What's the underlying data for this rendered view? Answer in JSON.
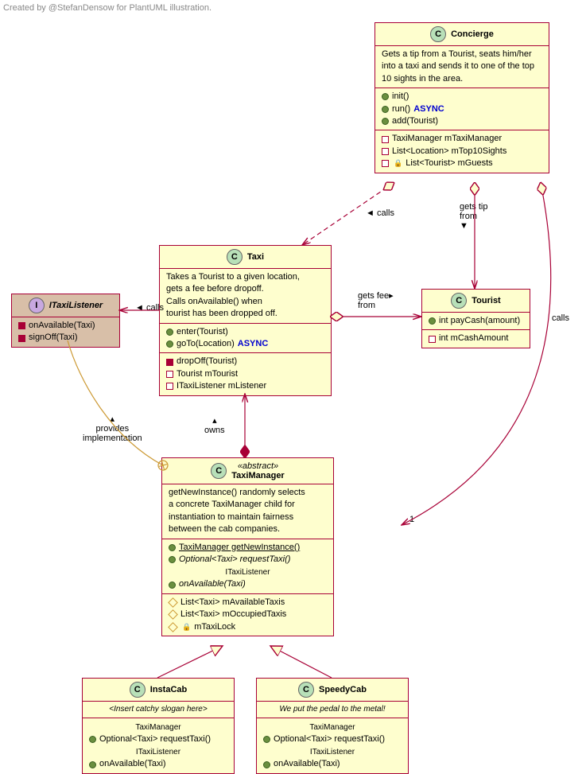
{
  "caption": "Created by @StefanDensow for PlantUML illustration.",
  "concierge": {
    "name": "Concierge",
    "desc": "Gets a tip from a Tourist, seats him/her into a taxi and sends it to one of the top 10 sights in the area.",
    "m_init": "init()",
    "m_run": "run()",
    "m_run_a": "ASYNC",
    "m_add": "add(Tourist)",
    "f1": "TaxiManager mTaxiManager",
    "f2": "List<Location> mTop10Sights",
    "f3": "List<Tourist> mGuests"
  },
  "taxi": {
    "name": "Taxi",
    "descL1": "Takes a Tourist to a given location,",
    "descL2": "gets a fee before dropoff.",
    "descL3": "Calls onAvailable() when",
    "descL4": "tourist has been dropped off.",
    "m_enter": "enter(Tourist)",
    "m_goto": "goTo(Location)",
    "m_goto_a": "ASYNC",
    "m_drop": "dropOff(Tourist)",
    "f1": "Tourist mTourist",
    "f2": "ITaxiListener mListener"
  },
  "itl": {
    "name": "ITaxiListener",
    "m1": "onAvailable(Taxi)",
    "m2": "signOff(Taxi)"
  },
  "tourist": {
    "name": "Tourist",
    "m1": "int payCash(amount)",
    "f1": "int mCashAmount"
  },
  "tm": {
    "stereo": "«abstract»",
    "name": "TaxiManager",
    "d1": "getNewInstance() randomly selects",
    "d2": "a concrete TaxiManager child for",
    "d3": "instantiation to maintain fairness",
    "d4": "between the cab companies.",
    "m1": "TaxiManager getNewInstance()",
    "m2": "Optional<Taxi> requestTaxi()",
    "sep1": "ITaxiListener",
    "m3": "onAvailable(Taxi)",
    "f1": "List<Taxi> mAvailableTaxis",
    "f2": "List<Taxi> mOccupiedTaxis",
    "f3": "mTaxiLock"
  },
  "insta": {
    "name": "InstaCab",
    "slogan": "<Insert catchy slogan here>",
    "sep1": "TaxiManager",
    "m1": "Optional<Taxi> requestTaxi()",
    "sep2": "ITaxiListener",
    "m2": "onAvailable(Taxi)"
  },
  "speedy": {
    "name": "SpeedyCab",
    "slogan": "We put the pedal to the metal!",
    "sep1": "TaxiManager",
    "m1": "Optional<Taxi> requestTaxi()",
    "sep2": "ITaxiListener",
    "m2": "onAvailable(Taxi)"
  },
  "rel": {
    "calls": "calls",
    "gets_tip": "gets tip",
    "from": "from",
    "gets_fee": "gets fee",
    "provides": "provides",
    "impl": "implementation",
    "owns": "owns",
    "one": "1"
  }
}
